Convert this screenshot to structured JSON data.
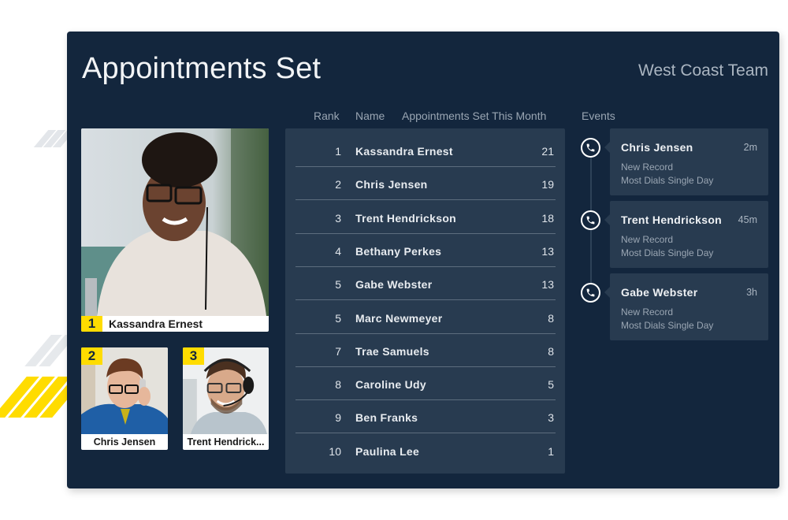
{
  "header": {
    "title": "Appointments Set",
    "team": "West Coast Team"
  },
  "leaders": [
    {
      "rank": "1",
      "name": "Kassandra Ernest"
    },
    {
      "rank": "2",
      "name": "Chris Jensen"
    },
    {
      "rank": "3",
      "name": "Trent Hendrick..."
    }
  ],
  "table": {
    "headers": {
      "rank": "Rank",
      "name": "Name",
      "count": "Appointments Set This Month"
    },
    "rows": [
      {
        "rank": "1",
        "name": "Kassandra Ernest",
        "count": "21"
      },
      {
        "rank": "2",
        "name": "Chris Jensen",
        "count": "19"
      },
      {
        "rank": "3",
        "name": "Trent Hendrickson",
        "count": "18"
      },
      {
        "rank": "4",
        "name": "Bethany Perkes",
        "count": "13"
      },
      {
        "rank": "5",
        "name": "Gabe Webster",
        "count": "13"
      },
      {
        "rank": "5",
        "name": "Marc Newmeyer",
        "count": "8"
      },
      {
        "rank": "7",
        "name": "Trae Samuels",
        "count": "8"
      },
      {
        "rank": "8",
        "name": "Caroline Udy",
        "count": "5"
      },
      {
        "rank": "9",
        "name": "Ben Franks",
        "count": "3"
      },
      {
        "rank": "10",
        "name": "Paulina Lee",
        "count": "1"
      }
    ]
  },
  "events": {
    "header": "Events",
    "icon": "phone-icon",
    "items": [
      {
        "name": "Chris Jensen",
        "time": "2m",
        "line1": "New Record",
        "line2": "Most Dials Single Day"
      },
      {
        "name": "Trent Hendrickson",
        "time": "45m",
        "line1": "New Record",
        "line2": "Most Dials Single Day"
      },
      {
        "name": "Gabe Webster",
        "time": "3h",
        "line1": "New Record",
        "line2": "Most Dials Single Day"
      }
    ]
  },
  "colors": {
    "panel": "#13263d",
    "table": "#283b50",
    "accent": "#ffdc00"
  }
}
